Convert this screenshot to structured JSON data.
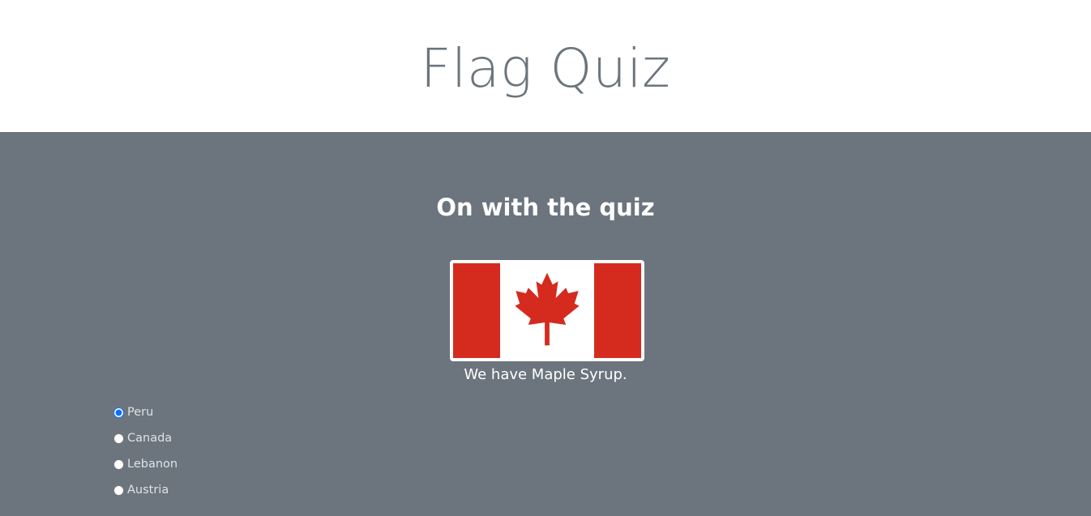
{
  "header": {
    "title": "Flag Quiz"
  },
  "quiz": {
    "heading": "On with the quiz",
    "flag_icon": "canada-flag",
    "flag_colors": {
      "red": "#d52b1e",
      "white": "#ffffff"
    },
    "hint": "We have Maple Syrup.",
    "options": [
      {
        "label": "Peru",
        "selected": true
      },
      {
        "label": "Canada",
        "selected": false
      },
      {
        "label": "Lebanon",
        "selected": false
      },
      {
        "label": "Austria",
        "selected": false
      }
    ]
  },
  "colors": {
    "background_main": "#6c757d",
    "title_text": "#6c757d",
    "radio_accent": "#0d6efd"
  }
}
